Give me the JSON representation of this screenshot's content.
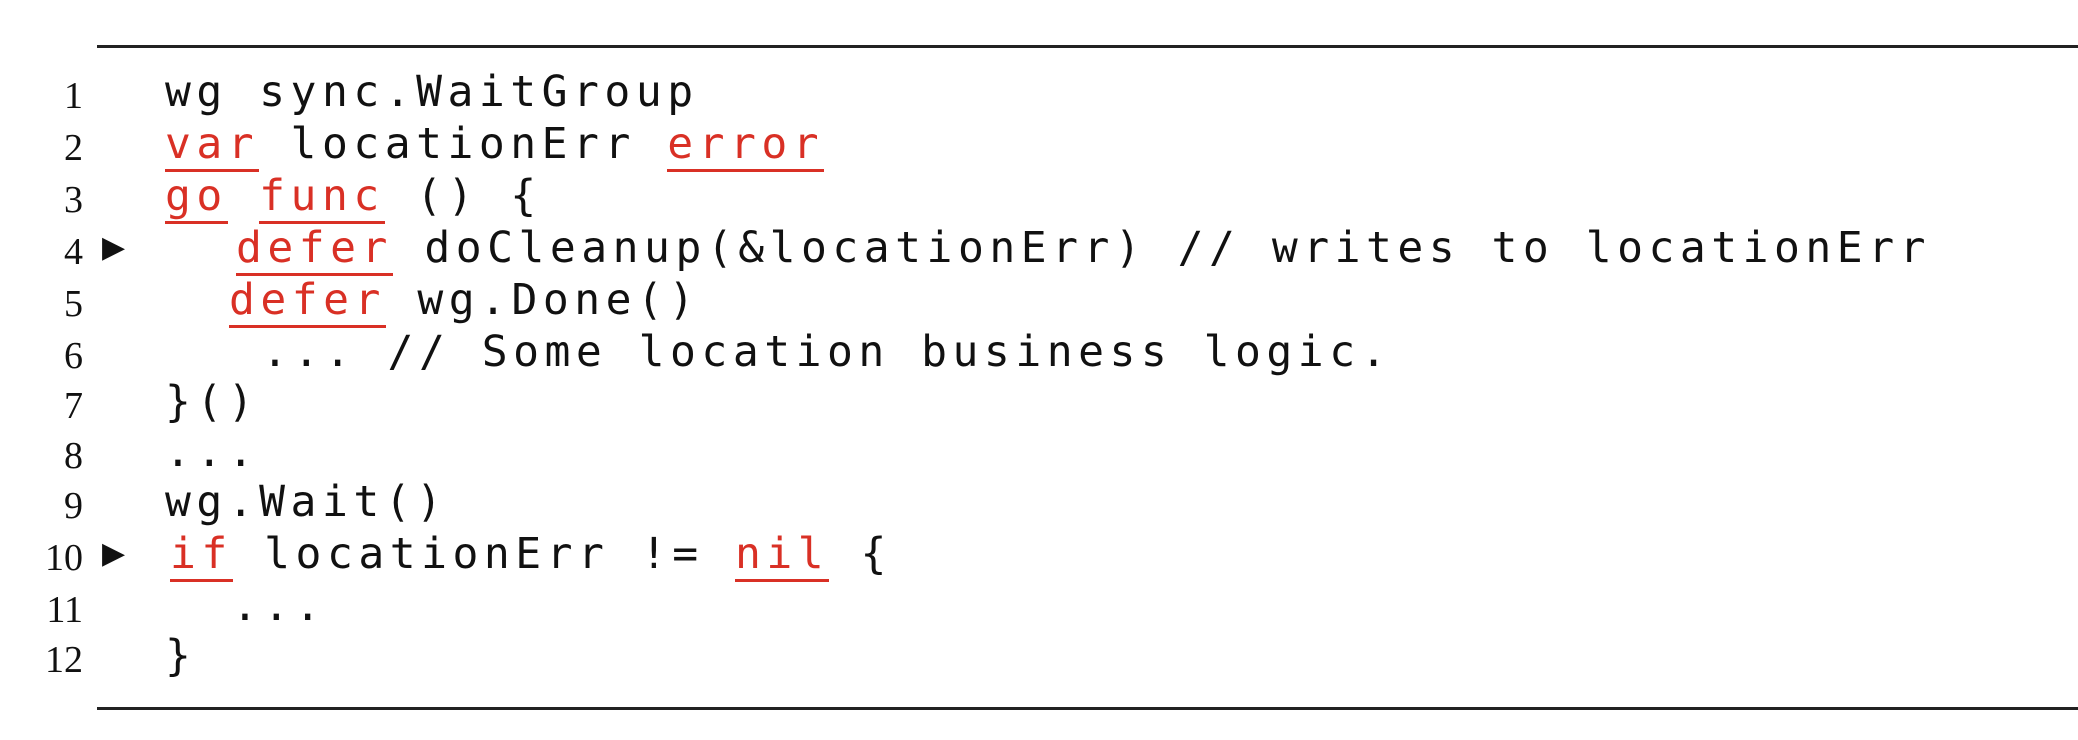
{
  "lines": [
    {
      "num": "1",
      "marker": "",
      "segments": [
        [
          "plain",
          "wg sync.WaitGroup"
        ]
      ]
    },
    {
      "num": "2",
      "marker": "",
      "segments": [
        [
          "kw",
          "var"
        ],
        [
          "plain",
          " locationErr "
        ],
        [
          "kw",
          "error"
        ]
      ]
    },
    {
      "num": "3",
      "marker": "",
      "segments": [
        [
          "kw",
          "go"
        ],
        [
          "plain",
          " "
        ],
        [
          "kw",
          "func"
        ],
        [
          "plain",
          " () {"
        ]
      ]
    },
    {
      "num": "4",
      "marker": "▶",
      "segments": [
        [
          "kw",
          "defer"
        ],
        [
          "plain",
          " doCleanup(&locationErr) // writes to locationErr"
        ]
      ]
    },
    {
      "num": "5",
      "marker": "",
      "segments": [
        [
          "kw",
          "defer"
        ],
        [
          "plain",
          " wg.Done()"
        ]
      ]
    },
    {
      "num": "6",
      "marker": "",
      "segments": [
        [
          "plain",
          "... // Some location business logic."
        ]
      ]
    },
    {
      "num": "7",
      "marker": "",
      "segments": [
        [
          "plain",
          "}()"
        ]
      ]
    },
    {
      "num": "8",
      "marker": "",
      "segments": [
        [
          "plain",
          "..."
        ]
      ]
    },
    {
      "num": "9",
      "marker": "",
      "segments": [
        [
          "plain",
          "wg.Wait()"
        ]
      ]
    },
    {
      "num": "10",
      "marker": "▶",
      "segments": [
        [
          "kw",
          "if"
        ],
        [
          "plain",
          " locationErr != "
        ],
        [
          "kw",
          "nil"
        ],
        [
          "plain",
          " {"
        ]
      ]
    },
    {
      "num": "11",
      "marker": "",
      "segments": [
        [
          "plain",
          "..."
        ]
      ]
    },
    {
      "num": "12",
      "marker": "",
      "segments": [
        [
          "plain",
          "}"
        ]
      ]
    }
  ],
  "colors": {
    "keyword": "#d93025",
    "text": "#111111"
  }
}
